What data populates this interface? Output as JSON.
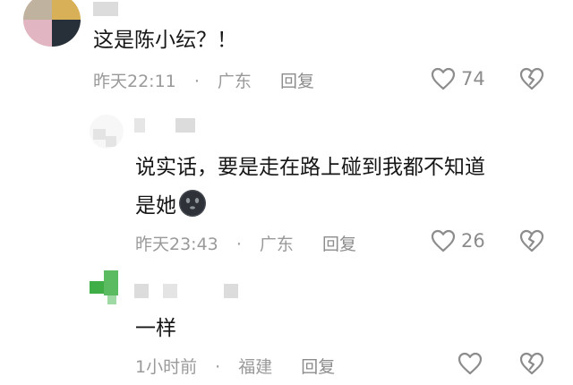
{
  "comments": [
    {
      "text": "这是陈小纭？！",
      "time": "昨天22:11",
      "location": "广东",
      "reply_label": "回复",
      "like_count": "74"
    },
    {
      "text_line1": "说实话，要是走在路上碰到我都不知道",
      "text_line2": "是她",
      "emoji_name": "dark-face-emoji",
      "time": "昨天23:43",
      "location": "广东",
      "reply_label": "回复",
      "like_count": "26"
    },
    {
      "text": "一样",
      "time": "1小时前",
      "location": "福建",
      "reply_label": "回复",
      "like_count": ""
    }
  ],
  "separator": "·",
  "icons": [
    "heart-icon",
    "broken-heart-icon"
  ],
  "colors": {
    "text": "#161616",
    "meta": "#9a9a9a",
    "icon": "#8c8c8c"
  }
}
